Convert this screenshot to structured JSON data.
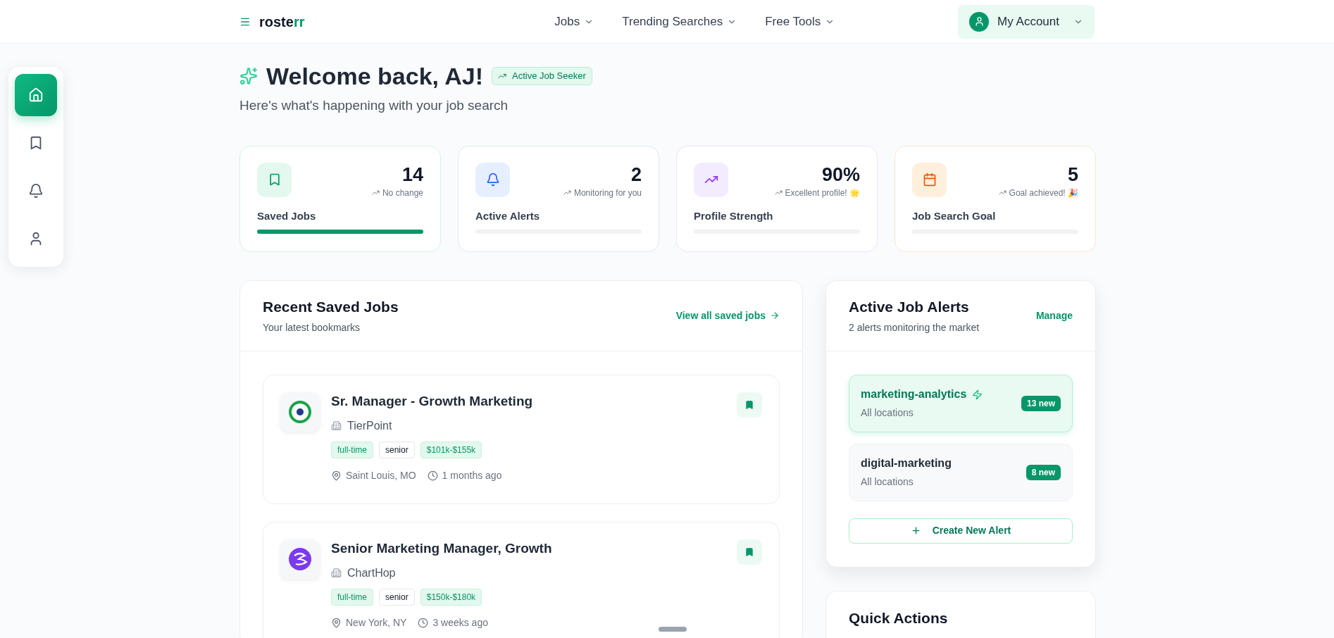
{
  "header": {
    "logo": {
      "text": "roste",
      "accent": "rr"
    },
    "nav": [
      {
        "label": "Jobs"
      },
      {
        "label": "Trending Searches"
      },
      {
        "label": "Free Tools"
      }
    ],
    "account": "My Account"
  },
  "sidebar": {
    "items": [
      {
        "kind": "home",
        "selected": true
      },
      {
        "kind": "bookmark",
        "selected": false
      },
      {
        "kind": "bell",
        "selected": false
      },
      {
        "kind": "user",
        "selected": false
      }
    ]
  },
  "welcome": {
    "title": "Welcome back, AJ!",
    "badge": "Active Job Seeker",
    "subtitle": "Here's what's happening with your job search"
  },
  "stats": [
    {
      "kind": "saved",
      "value": "14",
      "hint": "No change",
      "label": "Saved Jobs",
      "level": 1
    },
    {
      "kind": "alerts",
      "value": "2",
      "hint": "Monitoring for you",
      "label": "Active Alerts",
      "level": 0
    },
    {
      "kind": "profile",
      "value": "90%",
      "hint": "Excellent profile! 🌟",
      "label": "Profile Strength",
      "level": 0
    },
    {
      "kind": "goal",
      "value": "5",
      "hint": "Goal achieved! 🎉",
      "label": "Job Search Goal",
      "level": 0
    }
  ],
  "saved_jobs": {
    "title": "Recent Saved Jobs",
    "subtitle": "Your latest bookmarks",
    "link": "View all saved jobs",
    "jobs": [
      {
        "kind": "ring",
        "title": "Sr. Manager - Growth Marketing",
        "company": "TierPoint",
        "tags": [
          {
            "text": "full-time",
            "kind": "accent"
          },
          {
            "text": "senior",
            "kind": "plain"
          },
          {
            "text": "$101k-$155k",
            "kind": "accent"
          }
        ],
        "location": "Saint Louis, MO",
        "time": "1 months ago",
        "bookmarked": true
      },
      {
        "kind": "swirl",
        "title": "Senior Marketing Manager, Growth",
        "company": "ChartHop",
        "tags": [
          {
            "text": "full-time",
            "kind": "accent"
          },
          {
            "text": "senior",
            "kind": "plain"
          },
          {
            "text": "$150k-$180k",
            "kind": "accent"
          }
        ],
        "location": "New York, NY",
        "time": "3 weeks ago",
        "bookmarked": true
      }
    ]
  },
  "alerts": {
    "title": "Active Job Alerts",
    "subtitle": "2 alerts monitoring the market",
    "link": "Manage",
    "items": [
      {
        "name": "marketing-analytics",
        "location": "All locations",
        "count": "13 new",
        "selected": true
      },
      {
        "name": "digital-marketing",
        "location": "All locations",
        "count": "8 new",
        "selected": false
      }
    ],
    "create": "Create New Alert"
  },
  "quick_actions": {
    "title": "Quick Actions"
  }
}
